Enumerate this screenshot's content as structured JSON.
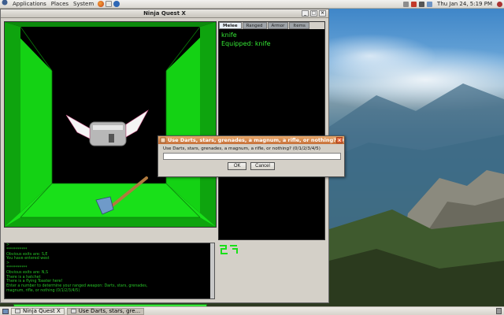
{
  "top_panel": {
    "menus": [
      "Applications",
      "Places",
      "System"
    ],
    "clock": "Thu Jan 24,  5:19 PM"
  },
  "window": {
    "title": "Ninja Quest X",
    "controls": [
      "minimize",
      "maximize",
      "close"
    ]
  },
  "inventory": {
    "tabs": [
      "Melee",
      "Ranged",
      "Armor",
      "Items"
    ],
    "active_tab": "Melee",
    "item_name": "knife",
    "equipped_label": "Equipped: knife"
  },
  "log": {
    "lines": [
      ">",
      "***********",
      "Obvious exits are: S,E",
      "You have entered west",
      ">",
      "***********",
      "Obvious exits are: N,S",
      "There is a hatchet",
      "There is a flying Toaster here!",
      "Enter a number to determine your ranged weapon: Darts, stars, grenades,",
      "magnum, rifle, or nothing (0/1/2/3/4/5)"
    ],
    "health_fraction": 1.0
  },
  "dialog": {
    "title": "Use Darts, stars, grenades, a magnum, a rifle, or nothing? (0/1/2/...",
    "prompt": "Use Darts, stars, grenades, a magnum, a rifle, or nothing? (0/1/2/3/4/5)",
    "input_value": "",
    "ok_label": "OK",
    "cancel_label": "Cancel"
  },
  "taskbar": {
    "items": [
      {
        "label": "Ninja Quest X",
        "active": false
      },
      {
        "label": "Use Darts, stars, gre...",
        "active": true
      }
    ]
  },
  "colors": {
    "corridor_green": "#19e019",
    "text_green": "#35e935",
    "dialog_titlebar": "#d27a44"
  }
}
